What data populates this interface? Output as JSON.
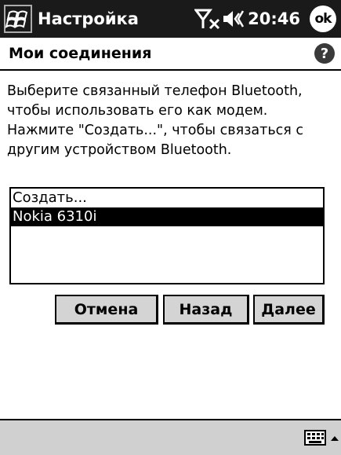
{
  "titlebar": {
    "title": "Настройка",
    "time": "20:46",
    "ok_label": "ok",
    "icons": [
      "windows-start-icon",
      "signal-off-icon",
      "speaker-icon"
    ]
  },
  "header": {
    "title": "Мои соединения",
    "help_label": "?"
  },
  "instructions": [
    "Выберите связанный телефон Bluetooth,",
    "чтобы использовать его как модем.",
    "Нажмите \"Создать...\", чтобы связаться с",
    "другим устройством Bluetooth."
  ],
  "list": {
    "items": [
      "Создать...",
      "Nokia 6310i"
    ],
    "selected_index": 1
  },
  "buttons": {
    "cancel": "Отмена",
    "back": "Назад",
    "next": "Далее"
  },
  "bottombar": {
    "icons": [
      "keyboard-icon",
      "arrow-up-icon"
    ]
  },
  "colors": {
    "titlebar_bg": "#1a1a1a",
    "selection_bg": "#000000",
    "button_bg": "#d4d4d4",
    "bottombar_bg": "#d0d0d0"
  }
}
